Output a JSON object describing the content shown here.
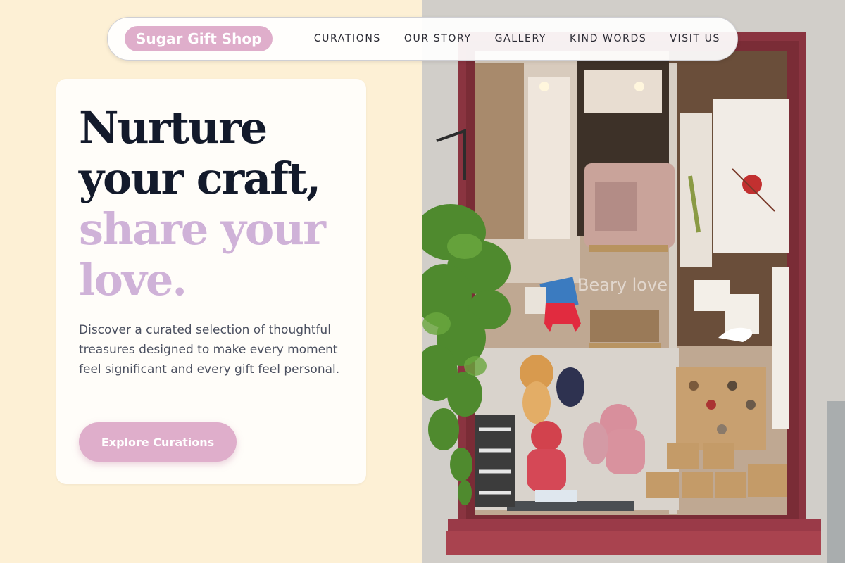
{
  "brand": {
    "name": "Sugar Gift Shop",
    "accent_color": "#dfaecb",
    "background_color": "#fdf0d5"
  },
  "nav": {
    "links": [
      "CURATIONS",
      "OUR STORY",
      "GALLERY",
      "KIND WORDS",
      "VISIT US"
    ]
  },
  "hero": {
    "headline_line1": "Nurture",
    "headline_line2": "your craft,",
    "headline_accent_line1": "share your",
    "headline_accent_line2": "love.",
    "headline_color": "#131a2b",
    "headline_accent_color": "#cfb2d8",
    "description": "Discover a curated selection of thoughtful treasures designed to make every moment feel significant and every gift feel personal.",
    "cta_label": "Explore Curations"
  },
  "photo": {
    "window_sign": "Beary love"
  }
}
